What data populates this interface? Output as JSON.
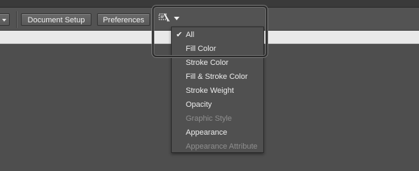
{
  "toolbar": {
    "document_setup_label": "Document Setup",
    "preferences_label": "Preferences",
    "recolor_icon": "recolor-artwork-icon"
  },
  "menu": {
    "items": [
      {
        "label": "All",
        "checked": true,
        "enabled": true
      },
      {
        "label": "Fill Color",
        "checked": false,
        "enabled": true
      },
      {
        "label": "Stroke Color",
        "checked": false,
        "enabled": true
      },
      {
        "label": "Fill & Stroke Color",
        "checked": false,
        "enabled": true
      },
      {
        "label": "Stroke Weight",
        "checked": false,
        "enabled": true
      },
      {
        "label": "Opacity",
        "checked": false,
        "enabled": true
      },
      {
        "label": "Graphic Style",
        "checked": false,
        "enabled": false
      },
      {
        "label": "Appearance",
        "checked": false,
        "enabled": true
      },
      {
        "label": "Appearance Attribute",
        "checked": false,
        "enabled": false
      }
    ],
    "check_glyph": "✔"
  },
  "colors": {
    "panel_bg": "#535353",
    "menu_bg": "#505050",
    "disabled_text": "#8f8f8f"
  }
}
